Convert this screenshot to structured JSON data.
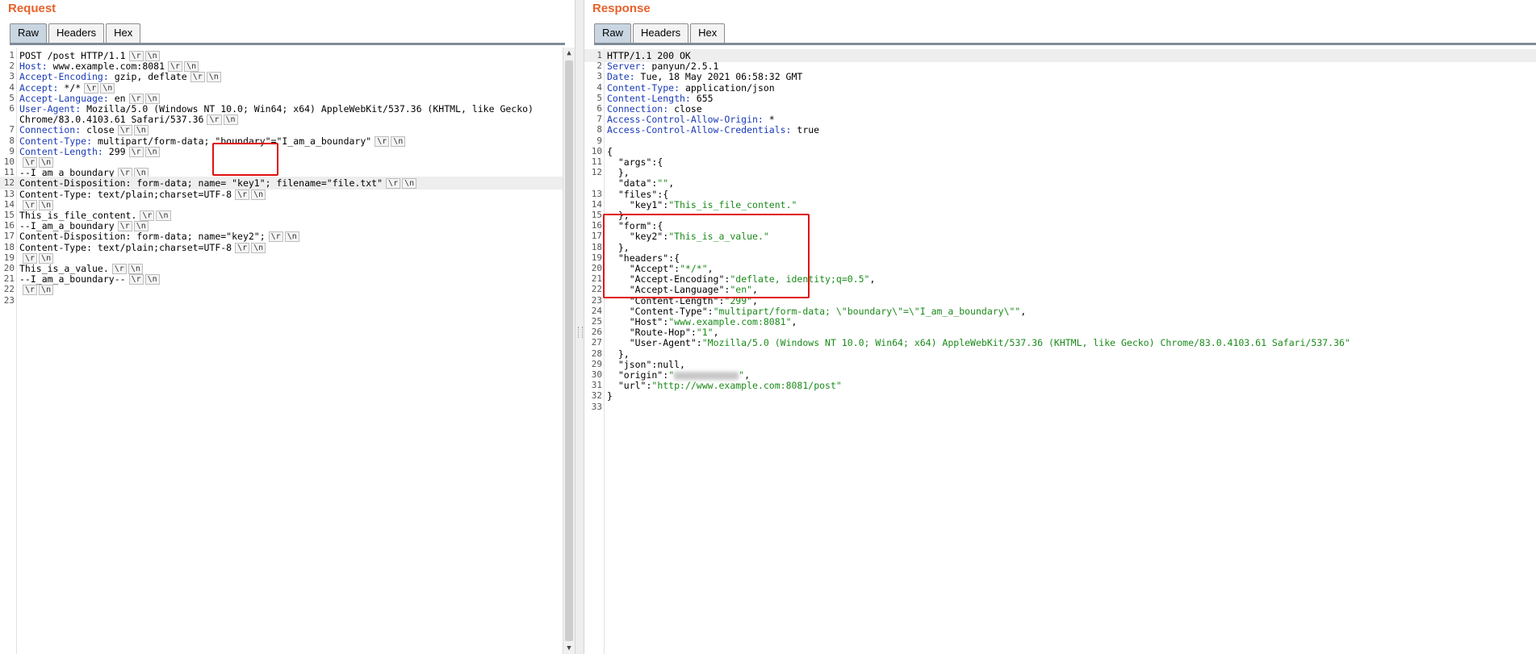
{
  "request": {
    "title": "Request",
    "tabs": [
      "Raw",
      "Headers",
      "Hex"
    ],
    "lines": [
      {
        "n": "1",
        "parts": [
          {
            "t": "POST /post HTTP/1.1",
            "c": "v"
          }
        ],
        "crlf": true
      },
      {
        "n": "2",
        "parts": [
          {
            "t": "Host:",
            "c": "k"
          },
          {
            "t": " www.example.com:8081",
            "c": "v"
          }
        ],
        "crlf": true
      },
      {
        "n": "3",
        "parts": [
          {
            "t": "Accept-Encoding:",
            "c": "k"
          },
          {
            "t": " gzip, deflate",
            "c": "v"
          }
        ],
        "crlf": true
      },
      {
        "n": "4",
        "parts": [
          {
            "t": "Accept:",
            "c": "k"
          },
          {
            "t": " */*",
            "c": "v"
          }
        ],
        "crlf": true
      },
      {
        "n": "5",
        "parts": [
          {
            "t": "Accept-Language:",
            "c": "k"
          },
          {
            "t": " en",
            "c": "v"
          }
        ],
        "crlf": true
      },
      {
        "n": "6",
        "parts": [
          {
            "t": "User-Agent:",
            "c": "k"
          },
          {
            "t": " Mozilla/5.0 (Windows NT 10.0; Win64; x64) AppleWebKit/537.36 (KHTML, like Gecko)",
            "c": "v"
          }
        ],
        "crlf": false
      },
      {
        "n": "",
        "parts": [
          {
            "t": "Chrome/83.0.4103.61 Safari/537.36",
            "c": "v"
          }
        ],
        "crlf": true
      },
      {
        "n": "7",
        "parts": [
          {
            "t": "Connection:",
            "c": "k"
          },
          {
            "t": " close",
            "c": "v"
          }
        ],
        "crlf": true
      },
      {
        "n": "8",
        "parts": [
          {
            "t": "Content-Type:",
            "c": "k"
          },
          {
            "t": " multipart/form-data; \"boundary\"=\"I_am_a_boundary\"",
            "c": "v"
          }
        ],
        "crlf": true
      },
      {
        "n": "9",
        "parts": [
          {
            "t": "Content-Length:",
            "c": "k"
          },
          {
            "t": " 299",
            "c": "v"
          }
        ],
        "crlf": true
      },
      {
        "n": "10",
        "parts": [],
        "crlf": true
      },
      {
        "n": "11",
        "parts": [
          {
            "t": "--I_am_a_boundary",
            "c": "v"
          }
        ],
        "crlf": true
      },
      {
        "n": "12",
        "parts": [
          {
            "t": "Content-Disposition: form-data; name= \"key1\"; filename=\"file.txt\"",
            "c": "v"
          }
        ],
        "crlf": true,
        "hl": true
      },
      {
        "n": "13",
        "parts": [
          {
            "t": "Content-Type: text/plain;charset=UTF-8",
            "c": "v"
          }
        ],
        "crlf": true
      },
      {
        "n": "14",
        "parts": [],
        "crlf": true
      },
      {
        "n": "15",
        "parts": [
          {
            "t": "This_is_file_content.",
            "c": "v"
          }
        ],
        "crlf": true
      },
      {
        "n": "16",
        "parts": [
          {
            "t": "--I_am_a_boundary",
            "c": "v"
          }
        ],
        "crlf": true
      },
      {
        "n": "17",
        "parts": [
          {
            "t": "Content-Disposition: form-data; name=\"key2\";",
            "c": "v"
          }
        ],
        "crlf": true
      },
      {
        "n": "18",
        "parts": [
          {
            "t": "Content-Type: text/plain;charset=UTF-8",
            "c": "v"
          }
        ],
        "crlf": true
      },
      {
        "n": "19",
        "parts": [],
        "crlf": true
      },
      {
        "n": "20",
        "parts": [
          {
            "t": "This_is_a_value.",
            "c": "v"
          }
        ],
        "crlf": true
      },
      {
        "n": "21",
        "parts": [
          {
            "t": "--I_am_a_boundary--",
            "c": "v"
          }
        ],
        "crlf": true
      },
      {
        "n": "22",
        "parts": [],
        "crlf": true
      },
      {
        "n": "23",
        "parts": [],
        "crlf": false
      }
    ]
  },
  "response": {
    "title": "Response",
    "tabs": [
      "Raw",
      "Headers",
      "Hex"
    ],
    "lines": [
      {
        "n": "1",
        "parts": [
          {
            "t": "HTTP/1.1 200 OK",
            "c": "v"
          }
        ],
        "hl": true
      },
      {
        "n": "2",
        "parts": [
          {
            "t": "Server:",
            "c": "k"
          },
          {
            "t": " panyun/2.5.1",
            "c": "v"
          }
        ]
      },
      {
        "n": "3",
        "parts": [
          {
            "t": "Date:",
            "c": "k"
          },
          {
            "t": " Tue, 18 May 2021 06:58:32 GMT",
            "c": "v"
          }
        ]
      },
      {
        "n": "4",
        "parts": [
          {
            "t": "Content-Type:",
            "c": "k"
          },
          {
            "t": " application/json",
            "c": "v"
          }
        ]
      },
      {
        "n": "5",
        "parts": [
          {
            "t": "Content-Length:",
            "c": "k"
          },
          {
            "t": " 655",
            "c": "v"
          }
        ]
      },
      {
        "n": "6",
        "parts": [
          {
            "t": "Connection:",
            "c": "k"
          },
          {
            "t": " close",
            "c": "v"
          }
        ]
      },
      {
        "n": "7",
        "parts": [
          {
            "t": "Access-Control-Allow-Origin:",
            "c": "k"
          },
          {
            "t": " *",
            "c": "v"
          }
        ]
      },
      {
        "n": "8",
        "parts": [
          {
            "t": "Access-Control-Allow-Credentials:",
            "c": "k"
          },
          {
            "t": " true",
            "c": "v"
          }
        ]
      },
      {
        "n": "9",
        "parts": []
      },
      {
        "n": "10",
        "parts": [
          {
            "t": "{",
            "c": "v"
          }
        ]
      },
      {
        "n": "11",
        "parts": [
          {
            "t": "  \"args\"",
            "c": "key"
          },
          {
            "t": ":{",
            "c": "v"
          }
        ]
      },
      {
        "n": "12",
        "parts": [
          {
            "t": "  },",
            "c": "v"
          }
        ]
      },
      {
        "n": "",
        "parts": [
          {
            "t": "  \"data\"",
            "c": "key"
          },
          {
            "t": ":",
            "c": "v"
          },
          {
            "t": "\"\"",
            "c": "str"
          },
          {
            "t": ",",
            "c": "v"
          }
        ]
      },
      {
        "n": "13",
        "parts": [
          {
            "t": "  \"files\"",
            "c": "key"
          },
          {
            "t": ":{",
            "c": "v"
          }
        ]
      },
      {
        "n": "14",
        "parts": [
          {
            "t": "    \"key1\"",
            "c": "key"
          },
          {
            "t": ":",
            "c": "v"
          },
          {
            "t": "\"This_is_file_content.\"",
            "c": "str"
          }
        ]
      },
      {
        "n": "15",
        "parts": [
          {
            "t": "  },",
            "c": "v"
          }
        ]
      },
      {
        "n": "16",
        "parts": [
          {
            "t": "  \"form\"",
            "c": "key"
          },
          {
            "t": ":{",
            "c": "v"
          }
        ]
      },
      {
        "n": "17",
        "parts": [
          {
            "t": "    \"key2\"",
            "c": "key"
          },
          {
            "t": ":",
            "c": "v"
          },
          {
            "t": "\"This_is_a_value.\"",
            "c": "str"
          }
        ]
      },
      {
        "n": "18",
        "parts": [
          {
            "t": "  },",
            "c": "v"
          }
        ]
      },
      {
        "n": "19",
        "parts": [
          {
            "t": "  \"headers\"",
            "c": "key"
          },
          {
            "t": ":{",
            "c": "v"
          }
        ]
      },
      {
        "n": "20",
        "parts": [
          {
            "t": "    \"Accept\"",
            "c": "key"
          },
          {
            "t": ":",
            "c": "v"
          },
          {
            "t": "\"*/*\"",
            "c": "str"
          },
          {
            "t": ",",
            "c": "v"
          }
        ]
      },
      {
        "n": "21",
        "parts": [
          {
            "t": "    \"Accept-Encoding\"",
            "c": "key"
          },
          {
            "t": ":",
            "c": "v"
          },
          {
            "t": "\"deflate, identity;q=0.5\"",
            "c": "str"
          },
          {
            "t": ",",
            "c": "v"
          }
        ]
      },
      {
        "n": "22",
        "parts": [
          {
            "t": "    \"Accept-Language\"",
            "c": "key"
          },
          {
            "t": ":",
            "c": "v"
          },
          {
            "t": "\"en\"",
            "c": "str"
          },
          {
            "t": ",",
            "c": "v"
          }
        ]
      },
      {
        "n": "23",
        "parts": [
          {
            "t": "    \"Content-Length\"",
            "c": "key"
          },
          {
            "t": ":",
            "c": "v"
          },
          {
            "t": "\"299\"",
            "c": "str"
          },
          {
            "t": ",",
            "c": "v"
          }
        ]
      },
      {
        "n": "24",
        "parts": [
          {
            "t": "    \"Content-Type\"",
            "c": "key"
          },
          {
            "t": ":",
            "c": "v"
          },
          {
            "t": "\"multipart/form-data; \\\"boundary\\\"=\\\"I_am_a_boundary\\\"\"",
            "c": "str"
          },
          {
            "t": ",",
            "c": "v"
          }
        ]
      },
      {
        "n": "25",
        "parts": [
          {
            "t": "    \"Host\"",
            "c": "key"
          },
          {
            "t": ":",
            "c": "v"
          },
          {
            "t": "\"www.example.com:8081\"",
            "c": "str"
          },
          {
            "t": ",",
            "c": "v"
          }
        ]
      },
      {
        "n": "26",
        "parts": [
          {
            "t": "    \"Route-Hop\"",
            "c": "key"
          },
          {
            "t": ":",
            "c": "v"
          },
          {
            "t": "\"1\"",
            "c": "str"
          },
          {
            "t": ",",
            "c": "v"
          }
        ]
      },
      {
        "n": "27",
        "parts": [
          {
            "t": "    \"User-Agent\"",
            "c": "key"
          },
          {
            "t": ":",
            "c": "v"
          },
          {
            "t": "\"Mozilla/5.0 (Windows NT 10.0; Win64; x64) AppleWebKit/537.36 (KHTML, like Gecko) Chrome/83.0.4103.61 Safari/537.36\"",
            "c": "str"
          }
        ]
      },
      {
        "n": "28",
        "parts": [
          {
            "t": "  },",
            "c": "v"
          }
        ]
      },
      {
        "n": "29",
        "parts": [
          {
            "t": "  \"json\"",
            "c": "key"
          },
          {
            "t": ":null,",
            "c": "v"
          }
        ]
      },
      {
        "n": "30",
        "parts": [
          {
            "t": "  \"origin\"",
            "c": "key"
          },
          {
            "t": ":",
            "c": "v"
          },
          {
            "t": "\"",
            "c": "str"
          },
          {
            "blur": true
          },
          {
            "t": "\"",
            "c": "str"
          },
          {
            "t": ",",
            "c": "v"
          }
        ]
      },
      {
        "n": "31",
        "parts": [
          {
            "t": "  \"url\"",
            "c": "key"
          },
          {
            "t": ":",
            "c": "v"
          },
          {
            "t": "\"http://www.example.com:8081/post\"",
            "c": "str"
          }
        ]
      },
      {
        "n": "32",
        "parts": [
          {
            "t": "}",
            "c": "v"
          }
        ]
      },
      {
        "n": "33",
        "parts": []
      }
    ]
  },
  "crlf": {
    "cr": "\\r",
    "lf": "\\n"
  },
  "colors": {
    "title": "#e8622b",
    "header_key": "#1a3ab8",
    "json_string": "#1a8a1a",
    "highlight_box": "#e01010"
  }
}
